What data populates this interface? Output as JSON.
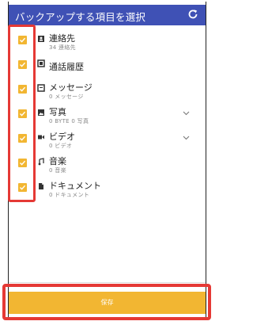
{
  "header": {
    "title": "バックアップする項目を選択",
    "refresh_icon": "refresh-icon"
  },
  "items": [
    {
      "title": "連絡先",
      "subtitle": "34 連絡先",
      "icon": "contacts-icon",
      "checked": true,
      "expandable": false
    },
    {
      "title": "通話履歴",
      "subtitle": "",
      "icon": "call-log-icon",
      "checked": true,
      "expandable": false
    },
    {
      "title": "メッセージ",
      "subtitle": "0 メッセージ",
      "icon": "message-icon",
      "checked": true,
      "expandable": false
    },
    {
      "title": "写真",
      "subtitle": "0 BYTE   0 写真",
      "icon": "photo-icon",
      "checked": true,
      "expandable": true
    },
    {
      "title": "ビデオ",
      "subtitle": "0 ビデオ",
      "icon": "video-icon",
      "checked": true,
      "expandable": true
    },
    {
      "title": "音楽",
      "subtitle": "0 音楽",
      "icon": "music-icon",
      "checked": true,
      "expandable": false
    },
    {
      "title": "ドキュメント",
      "subtitle": "0 ドキュメント",
      "icon": "document-icon",
      "checked": true,
      "expandable": false
    }
  ],
  "footer": {
    "save_label": "保存"
  },
  "colors": {
    "header": "#3f51b5",
    "accent": "#f2b632",
    "highlight": "#e53935"
  }
}
